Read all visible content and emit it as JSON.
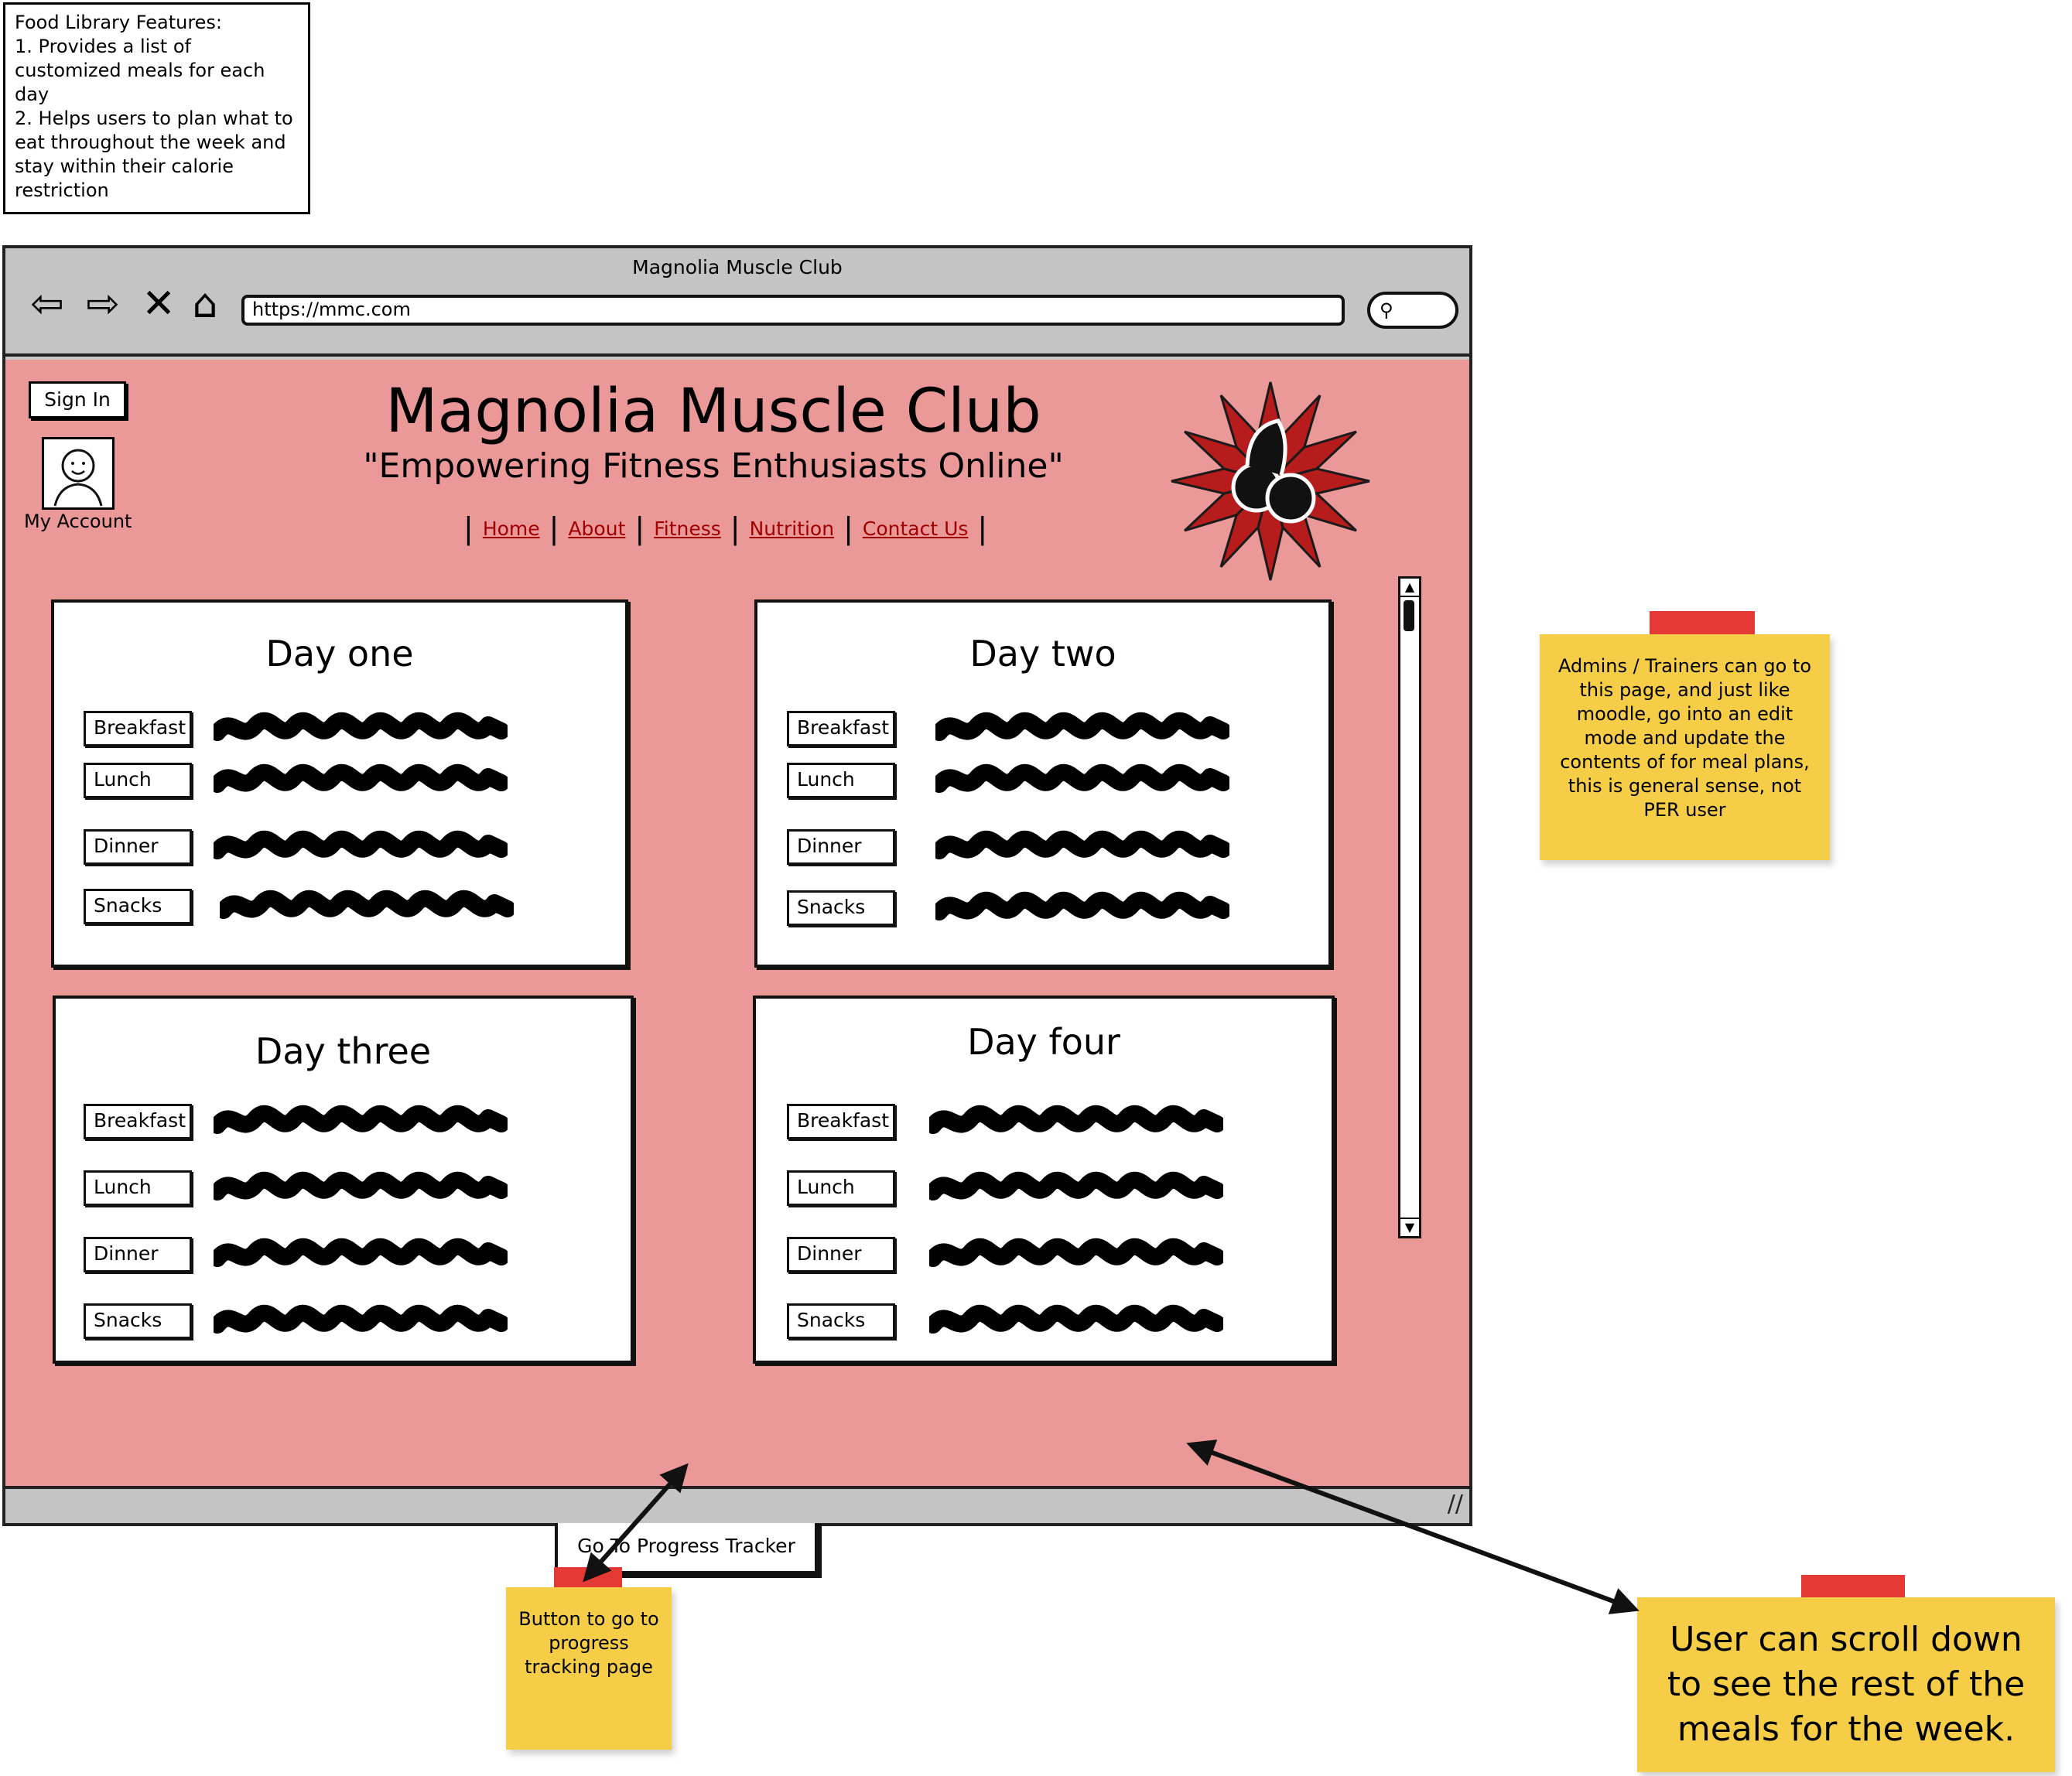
{
  "features_note": {
    "lines": [
      "Food Library Features:",
      "1. Provides a list of customized meals for each day",
      "2. Helps users to plan what to eat throughout the week and stay within their calorie restriction"
    ]
  },
  "browser": {
    "window_title": "Magnolia Muscle Club",
    "url": "https://mmc.com",
    "nav_icons": [
      "back-icon",
      "forward-icon",
      "stop-icon",
      "home-icon"
    ]
  },
  "header": {
    "sign_in_label": "Sign In",
    "account_label": "My Account",
    "site_title": "Magnolia Muscle Club",
    "tagline": "\"Empowering Fitness Enthusiasts Online\"",
    "nav": [
      "Home",
      "About",
      "Fitness",
      "Nutrition",
      "Contact Us"
    ]
  },
  "days": [
    {
      "title": "Day one",
      "meals": [
        "Breakfast",
        "Lunch",
        "Dinner",
        "Snacks"
      ]
    },
    {
      "title": "Day two",
      "meals": [
        "Breakfast",
        "Lunch",
        "Dinner",
        "Snacks"
      ]
    },
    {
      "title": "Day three",
      "meals": [
        "Breakfast",
        "Lunch",
        "Dinner",
        "Snacks"
      ]
    },
    {
      "title": "Day four",
      "meals": [
        "Breakfast",
        "Lunch",
        "Dinner",
        "Snacks"
      ]
    }
  ],
  "progress_button_label": "Go To Progress Tracker",
  "sticky_notes": {
    "admins": "Admins / Trainers can go to this page, and just like moodle, go into an edit mode and update the contents of for meal plans, this is general sense, not PER user",
    "button": "Button to go to progress tracking page",
    "scroll": "User can scroll down to see the rest of the meals for the week."
  },
  "colors": {
    "page_background": "#ea9898",
    "link": "#a00000",
    "sticky": "#f5cd47",
    "tape": "#e53935"
  }
}
